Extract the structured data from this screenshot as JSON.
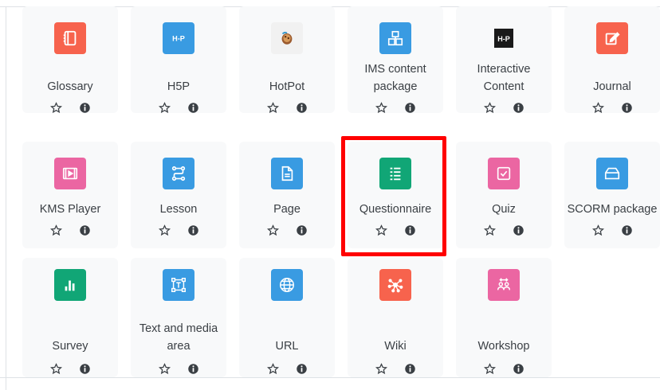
{
  "tiles": [
    {
      "name": "Glossary",
      "icon": "glossary-icon",
      "color": "#f7634d"
    },
    {
      "name": "H5P",
      "icon": "h5p-icon",
      "color": "#399be2"
    },
    {
      "name": "HotPot",
      "icon": "hotpot-icon",
      "color": "#f1f1f1"
    },
    {
      "name": "IMS content package",
      "icon": "ims-package-icon",
      "color": "#399be2"
    },
    {
      "name": "Interactive Content",
      "icon": "h5p-dark-icon",
      "color": "#1a1a1a"
    },
    {
      "name": "Journal",
      "icon": "journal-icon",
      "color": "#f7634d"
    },
    {
      "name": "KMS Player",
      "icon": "kms-player-icon",
      "color": "#eb66a2"
    },
    {
      "name": "Lesson",
      "icon": "lesson-icon",
      "color": "#399be2"
    },
    {
      "name": "Page",
      "icon": "page-icon",
      "color": "#399be2"
    },
    {
      "name": "Questionnaire",
      "icon": "questionnaire-icon",
      "color": "#11a676"
    },
    {
      "name": "Quiz",
      "icon": "quiz-icon",
      "color": "#eb66a2"
    },
    {
      "name": "SCORM package",
      "icon": "scorm-icon",
      "color": "#399be2"
    },
    {
      "name": "Survey",
      "icon": "survey-icon",
      "color": "#11a676"
    },
    {
      "name": "Text and media area",
      "icon": "text-media-icon",
      "color": "#399be2"
    },
    {
      "name": "URL",
      "icon": "url-icon",
      "color": "#399be2"
    },
    {
      "name": "Wiki",
      "icon": "wiki-icon",
      "color": "#f7634d"
    },
    {
      "name": "Workshop",
      "icon": "workshop-icon",
      "color": "#eb66a2"
    }
  ],
  "highlighted": "Questionnaire",
  "highlight_color": "#ff0000",
  "star_icon": "star-outline-icon",
  "info_icon": "info-icon"
}
